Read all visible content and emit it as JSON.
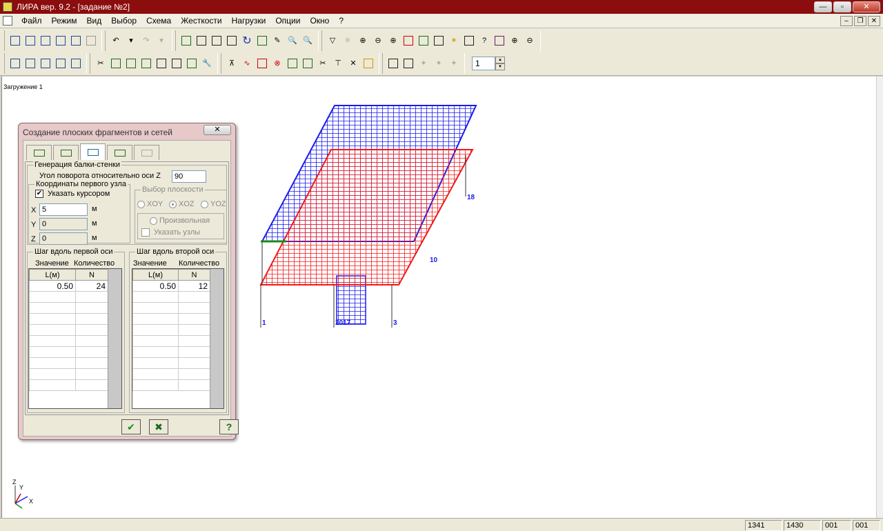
{
  "window": {
    "title": "ЛИРА  вер. 9.2 - [задание №2]",
    "min": "—",
    "max": "▫",
    "close": "✕"
  },
  "menu": [
    "Файл",
    "Режим",
    "Вид",
    "Выбор",
    "Схема",
    "Жесткости",
    "Нагрузки",
    "Опции",
    "Окно",
    "?"
  ],
  "mdi": {
    "min": "–",
    "restore": "❐",
    "close": "✕"
  },
  "canvas": {
    "load_label": "Загружение  1"
  },
  "toolbar2": {
    "spin_value": "1"
  },
  "dialog": {
    "title": "Создание плоских фрагментов и сетей",
    "close": "✕",
    "gen_group": "Генерация балки-стенки",
    "angle_label": "Угол поворота относительно оси Z",
    "angle_value": "90",
    "coords_group": "Координаты первого узла",
    "cursor_check": "Указать курсором",
    "x_label": "X",
    "x_value": "5",
    "x_unit": "м",
    "y_label": "Y",
    "y_value": "0",
    "y_unit": "м",
    "z_label": "Z",
    "z_value": "0",
    "z_unit": "м",
    "plane_group": "Выбор плоскости",
    "plane_xoy": "XOY",
    "plane_xoz": "XOZ",
    "plane_yoz": "YOZ",
    "arbitrary": "Произвольная",
    "specify_nodes": "Указать узлы",
    "step1_group": "Шаг вдоль первой оси",
    "step2_group": "Шаг вдоль второй оси",
    "col_value": "Значение",
    "col_count": "Количество",
    "hdr_l": "L(м)",
    "hdr_n": "N",
    "step1_rows": [
      {
        "l": "0.50",
        "n": "24"
      }
    ],
    "step2_rows": [
      {
        "l": "0.50",
        "n": "12"
      }
    ],
    "help": "?"
  },
  "model_labels": {
    "n1": "1",
    "n3": "3",
    "n10": "10",
    "n18": "18",
    "n2017": "2017"
  },
  "axis": {
    "z": "Z",
    "y": "Y",
    "x": "X"
  },
  "status": [
    "1341",
    "1430",
    "001",
    "001"
  ],
  "colors": {
    "title_bg": "#8b0d0d",
    "mesh_blue": "#1a1aee",
    "mesh_red": "#ee1a1a"
  }
}
